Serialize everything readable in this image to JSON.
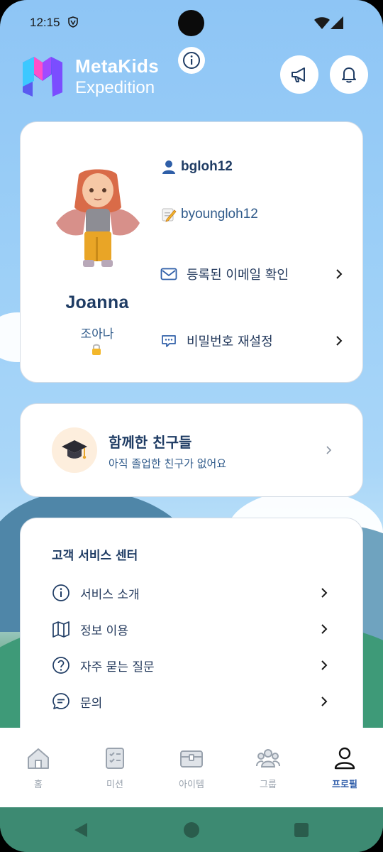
{
  "status_bar": {
    "time": "12:15",
    "icons": [
      "vpn-icon",
      "wifi-icon",
      "signal-icon"
    ]
  },
  "header": {
    "logo_line1": "MetaKids",
    "logo_line2": "Expedition",
    "buttons": [
      "info-icon",
      "megaphone-icon",
      "bell-icon"
    ]
  },
  "profile": {
    "display_name": "Joanna",
    "korean_name": "조아나",
    "username": "bgloh12",
    "nickname": "byoungloh12",
    "email_check_label": "등록된 이메일 확인",
    "password_reset_label": "비밀번호 재설정"
  },
  "friends": {
    "title": "함께한 친구들",
    "subtitle": "아직 졸업한 친구가 없어요"
  },
  "service": {
    "title": "고객 서비스 센터",
    "items": [
      {
        "label": "서비스 소개",
        "icon": "info-circle-icon"
      },
      {
        "label": "정보 이용",
        "icon": "map-icon"
      },
      {
        "label": "자주 묻는 질문",
        "icon": "question-circle-icon"
      },
      {
        "label": "문의",
        "icon": "chat-icon"
      }
    ]
  },
  "bottom_nav": {
    "tabs": [
      {
        "label": "홈",
        "icon": "home-icon"
      },
      {
        "label": "미션",
        "icon": "mission-icon"
      },
      {
        "label": "아이템",
        "icon": "chest-icon"
      },
      {
        "label": "그룹",
        "icon": "group-icon"
      },
      {
        "label": "프로필",
        "icon": "person-icon"
      }
    ],
    "active": "프로필"
  },
  "colors": {
    "accent": "#2b5aa8",
    "title_text": "#1f3c64",
    "sky": "#9ccff7"
  }
}
